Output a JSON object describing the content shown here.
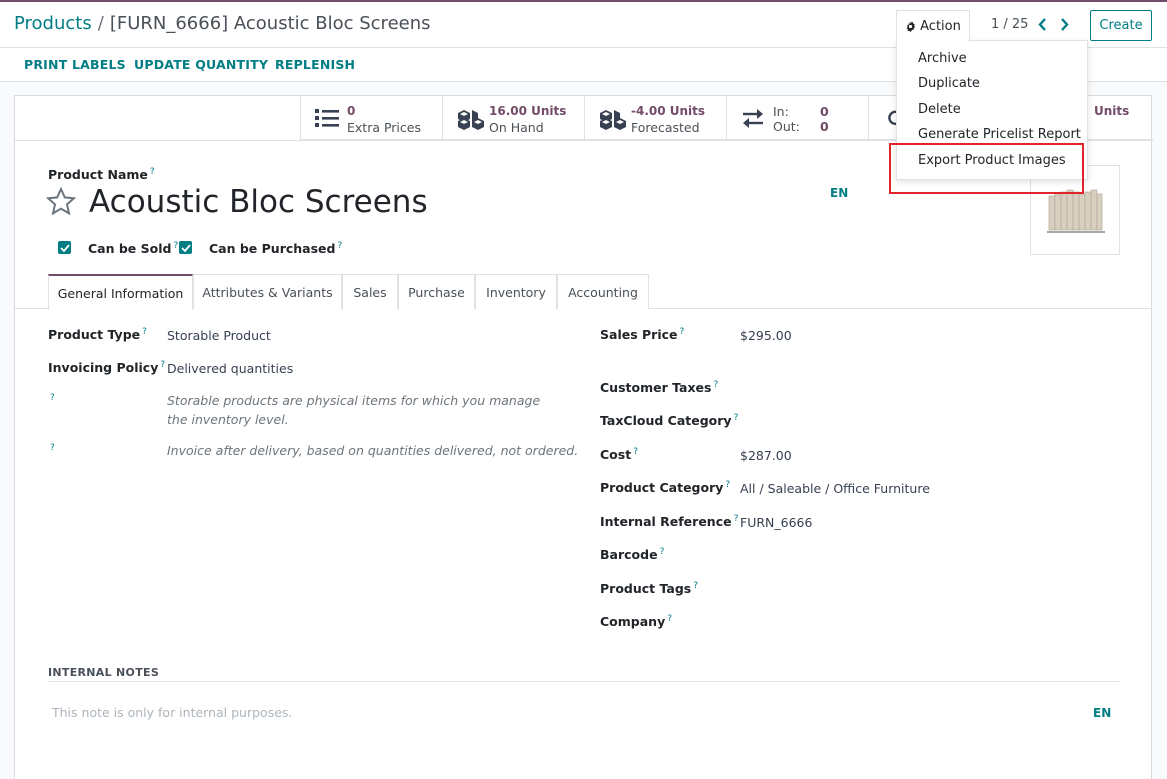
{
  "breadcrumb": {
    "root": "Products",
    "separator": "/",
    "current": "[FURN_6666] Acoustic Bloc Screens"
  },
  "toolbar": {
    "action_label": "Action",
    "pager": "1 / 25",
    "create_label": "Create"
  },
  "header_buttons": [
    "PRINT LABELS",
    "UPDATE QUANTITY",
    "REPLENISH"
  ],
  "stats": {
    "extra_prices": {
      "value": "0",
      "label": "Extra Prices"
    },
    "on_hand": {
      "value": "16.00 Units",
      "label": "On Hand"
    },
    "forecasted": {
      "value": "-4.00 Units",
      "label": "Forecasted"
    },
    "in_out": {
      "in_label": "In:",
      "in_value": "0",
      "out_label": "Out:",
      "out_value": "0"
    },
    "partial_value": "Units"
  },
  "action_menu": {
    "items": [
      "Archive",
      "Duplicate",
      "Delete",
      "Generate Pricelist Report",
      "Export Product Images"
    ],
    "highlighted": "Export Product Images",
    "highlight_color": "#e0262c"
  },
  "product": {
    "name_label": "Product Name",
    "name": "Acoustic Bloc Screens",
    "lang": "EN",
    "can_be_sold_label": "Can be Sold",
    "can_be_sold": true,
    "can_be_purchased_label": "Can be Purchased",
    "can_be_purchased": true
  },
  "tabs": [
    "General Information",
    "Attributes & Variants",
    "Sales",
    "Purchase",
    "Inventory",
    "Accounting"
  ],
  "active_tab": "General Information",
  "left_fields": {
    "product_type": {
      "label": "Product Type",
      "value": "Storable Product"
    },
    "invoicing_policy": {
      "label": "Invoicing Policy",
      "value": "Delivered quantities"
    },
    "help1": "Storable products are physical items for which you manage the inventory level.",
    "help2": "Invoice after delivery, based on quantities delivered, not ordered."
  },
  "right_fields": {
    "sales_price": {
      "label": "Sales Price",
      "value": "$295.00"
    },
    "customer_taxes": {
      "label": "Customer Taxes",
      "value": ""
    },
    "taxcloud_category": {
      "label": "TaxCloud Category",
      "value": ""
    },
    "cost": {
      "label": "Cost",
      "value": "$287.00"
    },
    "product_category": {
      "label": "Product Category",
      "value": "All / Saleable / Office Furniture"
    },
    "internal_reference": {
      "label": "Internal Reference",
      "value": "FURN_6666"
    },
    "barcode": {
      "label": "Barcode",
      "value": ""
    },
    "product_tags": {
      "label": "Product Tags",
      "value": ""
    },
    "company": {
      "label": "Company",
      "value": ""
    }
  },
  "notes": {
    "title": "INTERNAL NOTES",
    "placeholder": "This note is only for internal purposes.",
    "lang": "EN"
  },
  "help_mark": "?",
  "colors": {
    "brand": "#714b67",
    "accent": "#017e84"
  }
}
